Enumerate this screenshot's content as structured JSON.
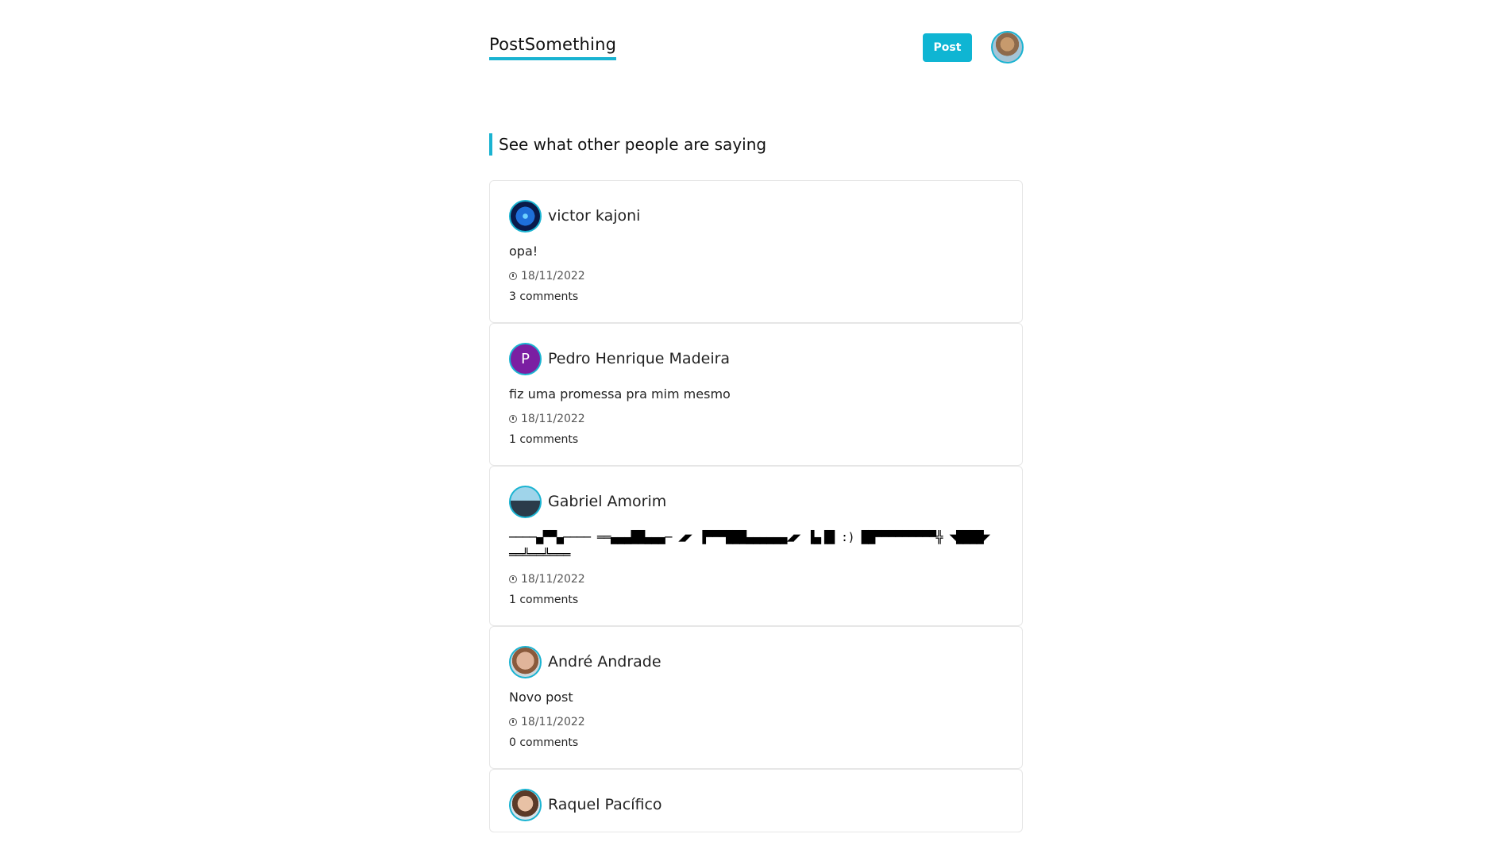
{
  "header": {
    "brand": "PostSomething",
    "post_button": "Post"
  },
  "section_title": "See what other people are saying",
  "posts": [
    {
      "author": "victor kajoni",
      "avatar_initial": "",
      "content": "opa!",
      "date": "18/11/2022",
      "comments": "3 comments"
    },
    {
      "author": "Pedro Henrique Madeira",
      "avatar_initial": "P",
      "content": "fiz uma promessa pra mim mesmo",
      "date": "18/11/2022",
      "comments": "1 comments"
    },
    {
      "author": "Gabriel Amorim",
      "avatar_initial": "",
      "content": "────▄▀▀▄──── ══▄▄▄██▄▄▄─ ◢◤ ▐▀▀▀███▄▄▄▄▄▄◢◤ ▐▄▐█ :) ██▀▀▀▀▀▀▀▀▀╬ ◥████◤ ══╩══╩═══",
      "date": "18/11/2022",
      "comments": "1 comments"
    },
    {
      "author": "André Andrade",
      "avatar_initial": "",
      "content": "Novo post",
      "date": "18/11/2022",
      "comments": "0 comments"
    },
    {
      "author": "Raquel Pacífico",
      "avatar_initial": "",
      "content": "",
      "date": "",
      "comments": ""
    }
  ],
  "colors": {
    "accent": "#1ab3d1",
    "button": "#0fb5d3"
  },
  "icons": {
    "date": "clock-icon"
  }
}
